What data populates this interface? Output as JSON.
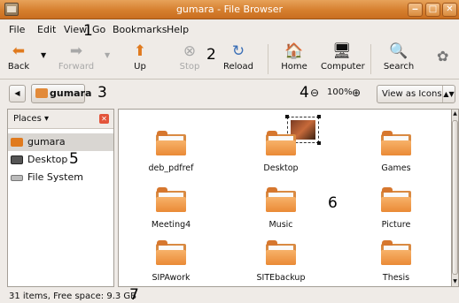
{
  "window": {
    "title": "gumara - File Browser"
  },
  "menubar": {
    "items": [
      "File",
      "Edit",
      "View",
      "Go",
      "Bookmarks",
      "Help"
    ]
  },
  "toolbar": {
    "back": "Back",
    "forward": "Forward",
    "up": "Up",
    "stop": "Stop",
    "reload": "Reload",
    "home": "Home",
    "computer": "Computer",
    "search": "Search"
  },
  "location": {
    "crumb": "gumara",
    "zoom": "100%",
    "view_mode": "View as Icons"
  },
  "sidebar": {
    "header": "Places",
    "items": [
      {
        "label": "gumara",
        "icon": "home-folder-icon",
        "selected": true
      },
      {
        "label": "Desktop",
        "icon": "desktop-icon",
        "selected": false
      },
      {
        "label": "File System",
        "icon": "drive-icon",
        "selected": false
      }
    ]
  },
  "files": [
    {
      "name": "deb_pdfref"
    },
    {
      "name": "Desktop"
    },
    {
      "name": "Games"
    },
    {
      "name": "Meeting4"
    },
    {
      "name": "Music"
    },
    {
      "name": "Picture"
    },
    {
      "name": "SIPAwork"
    },
    {
      "name": "SITEbackup"
    },
    {
      "name": "Thesis"
    }
  ],
  "status": {
    "text": "31 items, Free space: 9.3 GB"
  },
  "annotations": {
    "n1": "1",
    "n2": "2",
    "n3": "3",
    "n4": "4",
    "n5": "5",
    "n6": "6",
    "n7": "7"
  },
  "colors": {
    "title_bar": "#d67f2e",
    "folder": "#ea8a36",
    "selection": "#d9d6d2"
  }
}
